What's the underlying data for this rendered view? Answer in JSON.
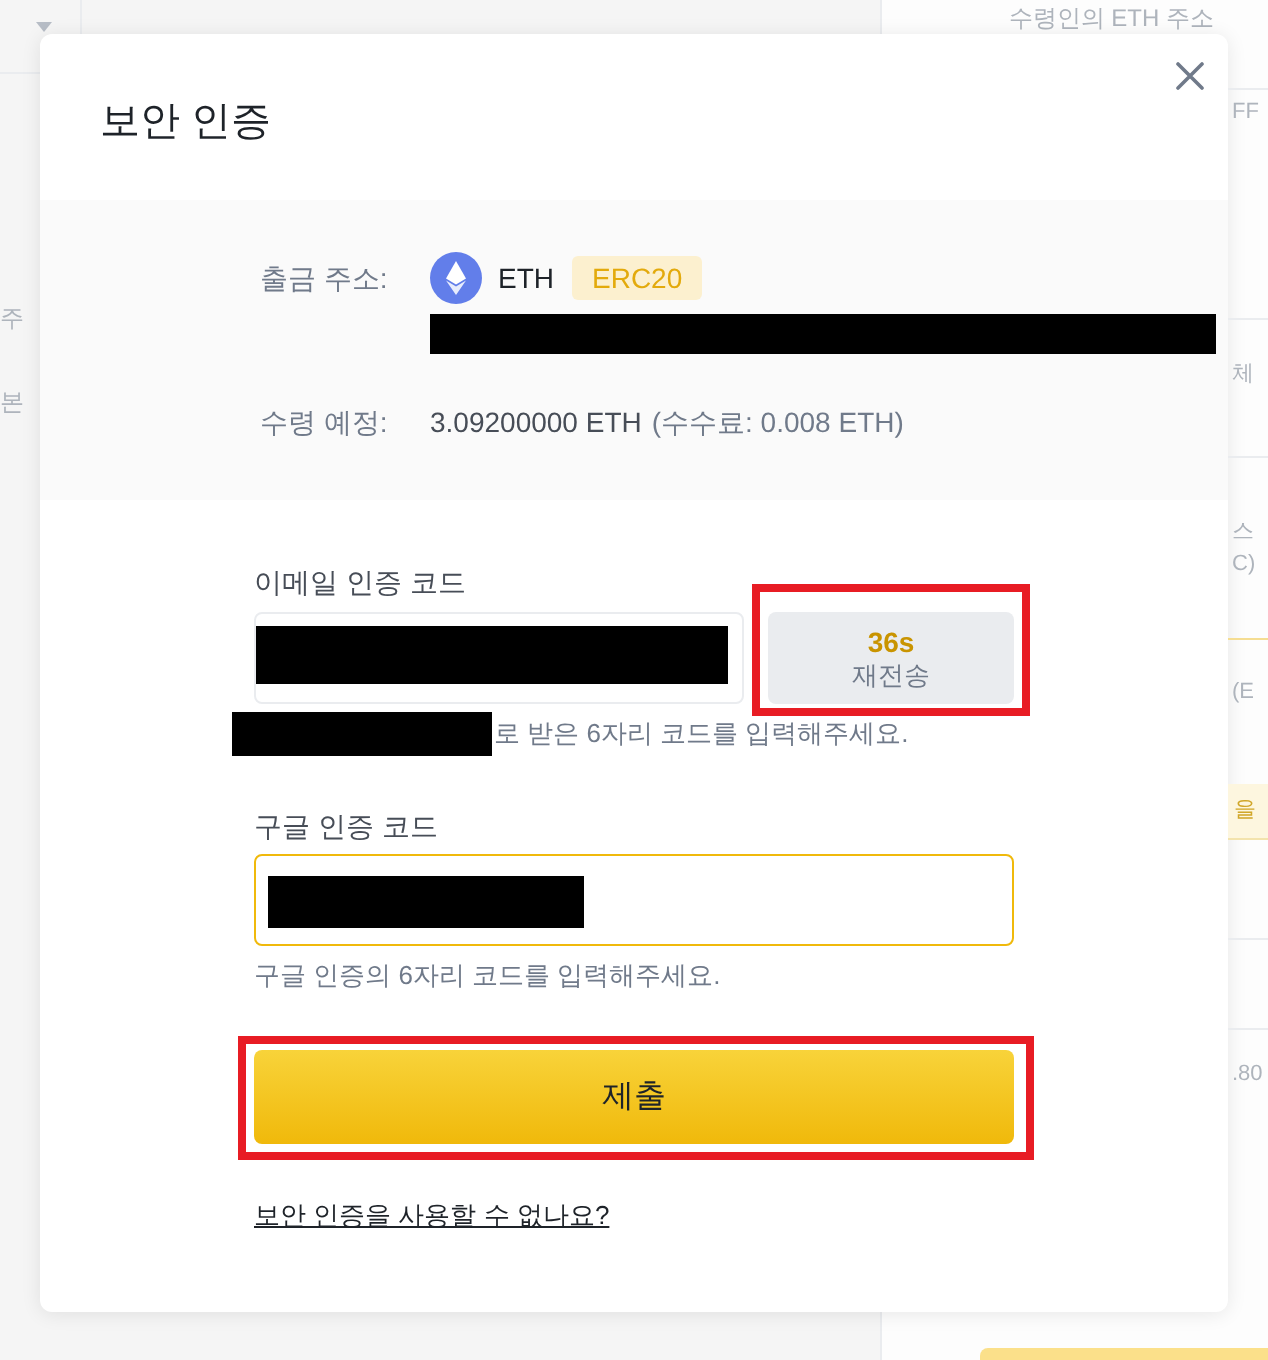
{
  "background": {
    "top_label": "수령인의 ETH 주소",
    "left_fragments": [
      "주",
      "본"
    ],
    "right_fragments": [
      {
        "text": "FF",
        "kind": "plain"
      },
      {
        "text": "체",
        "kind": "plain"
      },
      {
        "text": "스",
        "kind": "plain"
      },
      {
        "text": "C)",
        "kind": "plain"
      },
      {
        "text": "(E",
        "kind": "plain"
      },
      {
        "text": "을",
        "kind": "notice"
      },
      {
        "text": ".80",
        "kind": "plain"
      }
    ]
  },
  "dialog": {
    "title": "보안 인증",
    "summary": {
      "address_label": "출금 주소:",
      "coin": "ETH",
      "network": "ERC20",
      "address_redacted": true,
      "receive_label": "수령 예정:",
      "receive_amount": "3.09200000 ETH",
      "fee": "(수수료: 0.008 ETH)"
    },
    "email_code": {
      "label": "이메일 인증 코드",
      "value_redacted": true,
      "resend": {
        "countdown": "36s",
        "label": "재전송",
        "highlighted": true
      },
      "hint_prefix_redacted": true,
      "hint": "로 받은 6자리 코드를 입력해주세요."
    },
    "google_code": {
      "label": "구글 인증 코드",
      "focused": true,
      "value_redacted": true,
      "hint": "구글 인증의 6자리 코드를 입력해주세요."
    },
    "submit": {
      "label": "제출",
      "highlighted": true
    },
    "help_link": "보안 인증을 사용할 수 없나요?"
  }
}
